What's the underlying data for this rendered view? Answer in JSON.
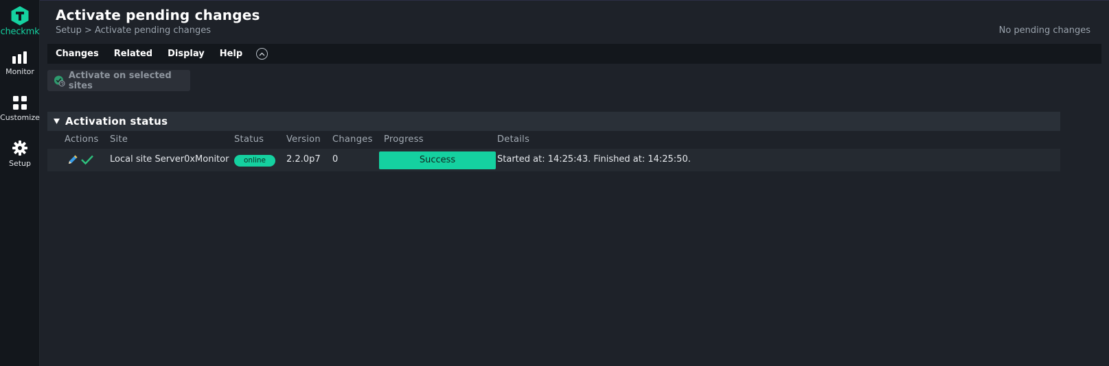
{
  "app": {
    "logo_text_1": "check",
    "logo_text_2": "mk",
    "brand_color": "#15d1a0"
  },
  "sidebar": {
    "items": [
      {
        "label": "Monitor",
        "icon": "bar-chart-icon"
      },
      {
        "label": "Customize",
        "icon": "grid-icon"
      },
      {
        "label": "Setup",
        "icon": "gear-icon"
      }
    ]
  },
  "header": {
    "title": "Activate pending changes",
    "breadcrumb": "Setup > Activate pending changes",
    "pending_status": "No pending changes"
  },
  "menu": {
    "items": [
      "Changes",
      "Related",
      "Display",
      "Help"
    ],
    "toggle_icon": "chevron-up-icon"
  },
  "toolbar": {
    "activate_label": "Activate on selected sites"
  },
  "activation": {
    "title": "Activation status",
    "columns": [
      "Actions",
      "Site",
      "Status",
      "Version",
      "Changes",
      "Progress",
      "Details"
    ],
    "rows": [
      {
        "site": "Local site Server0xMonitor",
        "status": "online",
        "version": "2.2.0p7",
        "changes": "0",
        "progress": "Success",
        "details": "Started at: 14:25:43. Finished at: 14:25:50."
      }
    ]
  }
}
